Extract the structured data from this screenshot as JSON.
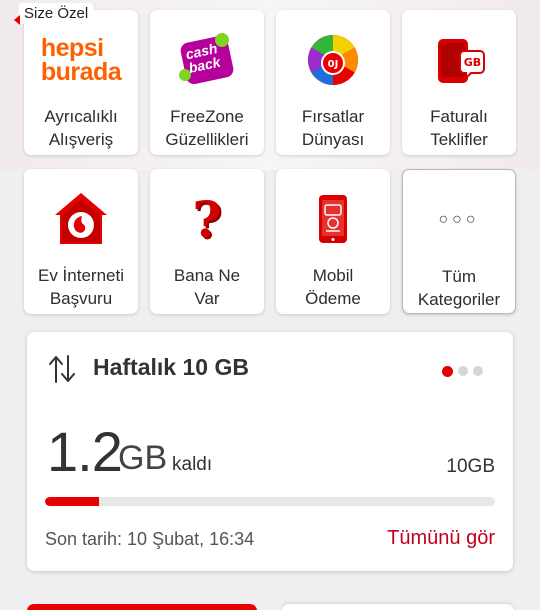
{
  "tooltip": "Size Özel",
  "tiles": [
    {
      "label": "Ayrıcalıklı\nAlışveriş",
      "icon": "hepsiburada-logo",
      "logo_lines": [
        "hepsi",
        "burada"
      ],
      "logo_color": "#ff6000"
    },
    {
      "label": "FreeZone\nGüzellikleri",
      "icon": "cashback-icon",
      "logo_lines": [
        "cash",
        "back"
      ],
      "logo_color": "#b0009e"
    },
    {
      "label": "Fırsatlar\nDünyası",
      "icon": "prize-wheel-icon"
    },
    {
      "label": "Faturalı\nTeklifler",
      "icon": "phone-gb-icon",
      "badge": "GB"
    },
    {
      "label": "Ev İnterneti\nBaşvuru",
      "icon": "home-vodafone-icon"
    },
    {
      "label": "Bana Ne\nVar",
      "icon": "question-mark-icon",
      "glyph": "?"
    },
    {
      "label": "Mobil\nÖdeme",
      "icon": "mobile-payment-icon"
    },
    {
      "label": "Tüm\nKategoriler",
      "icon": "more-dots-icon",
      "glyph": "○○○"
    }
  ],
  "data_card": {
    "title": "Haftalık 10 GB",
    "amount": "1.2",
    "unit": "GB",
    "remaining_label": "kaldı",
    "total": "10GB",
    "progress_fraction": 0.12,
    "date_text": "Son tarih: 10 Şubat, 16:34",
    "see_all": "Tümünü gör",
    "carousel_pages": 3,
    "carousel_active": 0
  },
  "colors": {
    "accent": "#e60000",
    "link": "#c4001d"
  }
}
